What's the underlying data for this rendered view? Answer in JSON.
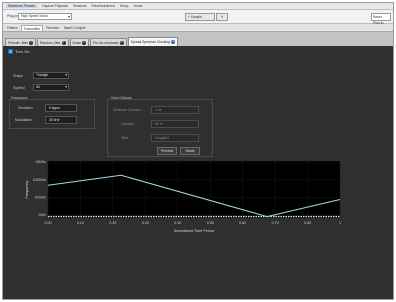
{
  "menubar": [
    "Waveform Presets",
    "Capture Playback",
    "Sessions",
    "Files/Instrument",
    "Setup",
    "Home"
  ],
  "toolbar": {
    "plugin_label": "Plug-In",
    "plugin_value": "High Speed Serial",
    "sweep_label": "Sample",
    "reset_label": "Reset Plug-In"
  },
  "subtabs": [
    "Pattern",
    "Transmitter",
    "Receiver",
    "Batch Compile"
  ],
  "tabs": [
    "Periodic Jitter",
    "Random Jitter",
    "Noise",
    "Pre-De-emphasis",
    "Spread Spectrum Clocking"
  ],
  "panel": {
    "turn_on": "Turn On",
    "shape_label": "Shape",
    "shape_value": "Triangle",
    "symbol_label": "Symbol",
    "symbol_value": "All",
    "frequency_group": "Frequency",
    "deviation_label": "Deviation",
    "deviation_value": "5 kppm",
    "modulation_label": "Modulation",
    "modulation_value": "30 kHz",
    "views_group": "View Options",
    "mod_duration_label": "Minimum Duration",
    "mod_duration_value": "1 us",
    "variation_label": "Variation",
    "variation_value": "50 %",
    "jitter_label": "Jitter",
    "jitter_value": "0 Applied",
    "preview_label": "Preview",
    "reset_label": "Reset"
  },
  "chart_data": {
    "type": "line",
    "xlabel": "Normalized Time Period",
    "ylabel": "Frequency",
    "x_ticks": [
      "0.00",
      "0.10",
      "0.20",
      "0.30",
      "0.40",
      "0.50",
      "0.60",
      "0.70",
      "0.80",
      "1"
    ],
    "y_ticks": [
      "10MHz",
      "1000kHz",
      "100kHz",
      "10Hz"
    ],
    "xlim": [
      0,
      1
    ],
    "ylim": [
      0,
      4
    ],
    "series": [
      {
        "x": [
          0,
          0.25,
          0.75,
          1
        ],
        "y": [
          2.3,
          3.0,
          0.1,
          1.3
        ],
        "color": "#a9d6ea"
      }
    ],
    "baseline": {
      "y": 0.1,
      "color": "#e8e8e8"
    },
    "grid": true,
    "background": "#000000"
  }
}
